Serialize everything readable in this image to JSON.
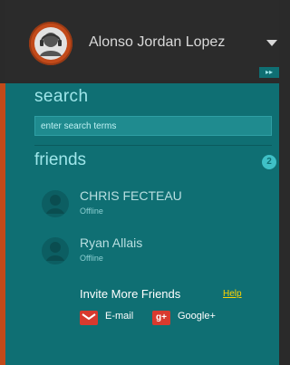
{
  "header": {
    "username": "Alonso Jordan Lopez"
  },
  "search": {
    "title": "search",
    "placeholder": "enter search terms"
  },
  "friends": {
    "title": "friends",
    "count": "2",
    "items": [
      {
        "name": "CHRIS FECTEAU",
        "status": "Offline"
      },
      {
        "name": "Ryan Allais",
        "status": "Offline"
      }
    ]
  },
  "invite": {
    "title": "Invite More Friends",
    "help": "Help",
    "email": "E-mail",
    "google": "Google+"
  },
  "colors": {
    "panel": "#0f6f73",
    "accent": "#c24a1a",
    "link": "#ffd400"
  },
  "icons": {
    "avatar": "user-headphones-icon",
    "caret": "chevron-down-icon",
    "collapse": "collapse-arrows-icon",
    "email": "email-icon",
    "google": "google-plus-icon"
  }
}
